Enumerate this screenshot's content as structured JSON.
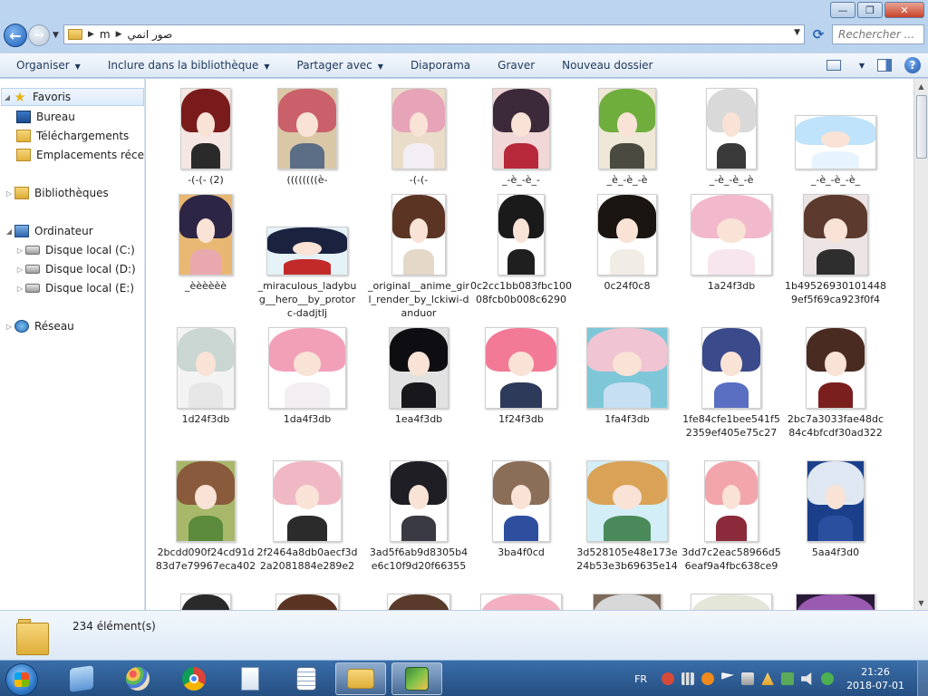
{
  "window": {
    "minimize_glyph": "—",
    "maximize_glyph": "❐",
    "close_glyph": "✕"
  },
  "address": {
    "crumbs": [
      "m",
      "صور انمي"
    ],
    "search_placeholder": "Rechercher ..."
  },
  "toolbar": {
    "organize": "Organiser",
    "include_library": "Inclure dans la bibliothèque",
    "share_with": "Partager avec",
    "slideshow": "Diaporama",
    "burn": "Graver",
    "new_folder": "Nouveau dossier",
    "help_glyph": "?"
  },
  "navpane": {
    "favorites": "Favoris",
    "desktop": "Bureau",
    "downloads": "Téléchargements",
    "recent": "Emplacements récer",
    "libraries": "Bibliothèques",
    "computer": "Ordinateur",
    "disk_c": "Disque local (C:)",
    "disk_d": "Disque local (D:)",
    "disk_e": "Disque local (E:)",
    "network": "Réseau"
  },
  "files": [
    {
      "name": "-(-(- (2)",
      "hair": "#7a1b1b",
      "body": "#2a2a2a",
      "bg": "#f4e6e2"
    },
    {
      "name": "((((((((è-",
      "hair": "#c9606a",
      "body": "#5b6e86",
      "bg": "#d9c7a6"
    },
    {
      "name": "-(-(-",
      "hair": "#e7a4b8",
      "body": "#f2eef3",
      "bg": "#e9dcc8"
    },
    {
      "name": "_-è_-è_-",
      "hair": "#3c2a3a",
      "body": "#b7283a",
      "bg": "#f1d7d7"
    },
    {
      "name": "_è_-è_-è",
      "hair": "#6fae3c",
      "body": "#4a4a40",
      "bg": "#efe7d7"
    },
    {
      "name": "_-è_-è_-è",
      "hair": "#d9d9d9",
      "body": "#3a3a3a",
      "bg": "#ffffff"
    },
    {
      "name": "_-è_-è_-è_",
      "hair": "#bfe3fb",
      "body": "#e8f4fd",
      "bg": "#ffffff"
    },
    {
      "name": "_èèèèèè",
      "hair": "#2d2545",
      "body": "#e9a7ae",
      "bg": "#e8b873"
    },
    {
      "name": "_miraculous_ladybug__hero__by_protorc-dadjtlj",
      "hair": "#1a2240",
      "body": "#c22a2a",
      "bg": "#e5f2f8"
    },
    {
      "name": "_original__anime_girl_render_by_lckiwi-danduor",
      "hair": "#5b3423",
      "body": "#e4d8c8",
      "bg": "#ffffff"
    },
    {
      "name": "0c2cc1bb083fbc10008fcb0b008c6290",
      "hair": "#1a1a1a",
      "body": "#1f1f1f",
      "bg": "#ffffff"
    },
    {
      "name": "0c24f0c8",
      "hair": "#1b1512",
      "body": "#f1ece6",
      "bg": "#ffffff"
    },
    {
      "name": "1a24f3db",
      "hair": "#f2b9cc",
      "body": "#f7e6ee",
      "bg": "#ffffff"
    },
    {
      "name": "1b495269301014489ef5f69ca923f0f4",
      "hair": "#5c3a2d",
      "body": "#2e2e2e",
      "bg": "#ece4e4"
    },
    {
      "name": "1d24f3db",
      "hair": "#c9d6d2",
      "body": "#e6e6e6",
      "bg": "#f3f3f3"
    },
    {
      "name": "1da4f3db",
      "hair": "#f2a0b8",
      "body": "#f3eef2",
      "bg": "#ffffff"
    },
    {
      "name": "1ea4f3db",
      "hair": "#0e0e12",
      "body": "#18181c",
      "bg": "#e2e2e2"
    },
    {
      "name": "1f24f3db",
      "hair": "#f27a97",
      "body": "#2d3a5a",
      "bg": "#ffffff"
    },
    {
      "name": "1fa4f3db",
      "hair": "#f0c4d2",
      "body": "#c7dff2",
      "bg": "#7ec7d8"
    },
    {
      "name": "1fe84cfe1bee541f52359ef405e75c27",
      "hair": "#3b4a8a",
      "body": "#5a6fc2",
      "bg": "#ffffff"
    },
    {
      "name": "2bc7a3033fae48dc84c4bfcdf30ad322",
      "hair": "#4a2b22",
      "body": "#7a1e1e",
      "bg": "#ffffff"
    },
    {
      "name": "2bcdd090f24cd91d83d7e79967eca402",
      "hair": "#8a5a3c",
      "body": "#5b8a3c",
      "bg": "#a8b86a"
    },
    {
      "name": "2f2464a8db0aecf3d2a2081884e289e2",
      "hair": "#f0b8c4",
      "body": "#2b2b2b",
      "bg": "#ffffff"
    },
    {
      "name": "3ad5f6ab9d8305b4e6c10f9d20f66355",
      "hair": "#1e1e24",
      "body": "#3a3a44",
      "bg": "#ffffff"
    },
    {
      "name": "3ba4f0cd",
      "hair": "#8a6e58",
      "body": "#2d4f9e",
      "bg": "#ffffff"
    },
    {
      "name": "3d528105e48e173e24b53e3b69635e14",
      "hair": "#d9a256",
      "body": "#4a8a5a",
      "bg": "#d3eef7"
    },
    {
      "name": "3dd7c2eac58966d56eaf9a4fbc638ce9",
      "hair": "#f2a5ab",
      "body": "#8a2a3a",
      "bg": "#ffffff"
    },
    {
      "name": "5aa4f3d0",
      "hair": "#dfe8f2",
      "body": "#2a4f9e",
      "bg": "#1b3f8a"
    },
    {
      "name": "",
      "hair": "#2a2a2a",
      "body": "#ffffff",
      "bg": "#ffffff"
    },
    {
      "name": "",
      "hair": "#5a3323",
      "body": "#ffffff",
      "bg": "#ffffff"
    },
    {
      "name": "",
      "hair": "#5a3a2a",
      "body": "#ffffff",
      "bg": "#ffffff"
    },
    {
      "name": "",
      "hair": "#f2b0c0",
      "body": "#ffffff",
      "bg": "#ffffff"
    },
    {
      "name": "",
      "hair": "#d8d8d8",
      "body": "#ffffff",
      "bg": "#7d6a5a"
    },
    {
      "name": "",
      "hair": "#e3e6d9",
      "body": "#ffffff",
      "bg": "#ffffff"
    },
    {
      "name": "",
      "hair": "#9a5ab0",
      "body": "#ffffff",
      "bg": "#2a1a3a"
    }
  ],
  "details": {
    "count": "234 élément(s)"
  },
  "taskbar": {
    "lang": "FR",
    "time": "21:26",
    "date": "2018-07-01"
  },
  "colors": {
    "accent": "#2a66b3",
    "taskbar": "#254f82"
  }
}
